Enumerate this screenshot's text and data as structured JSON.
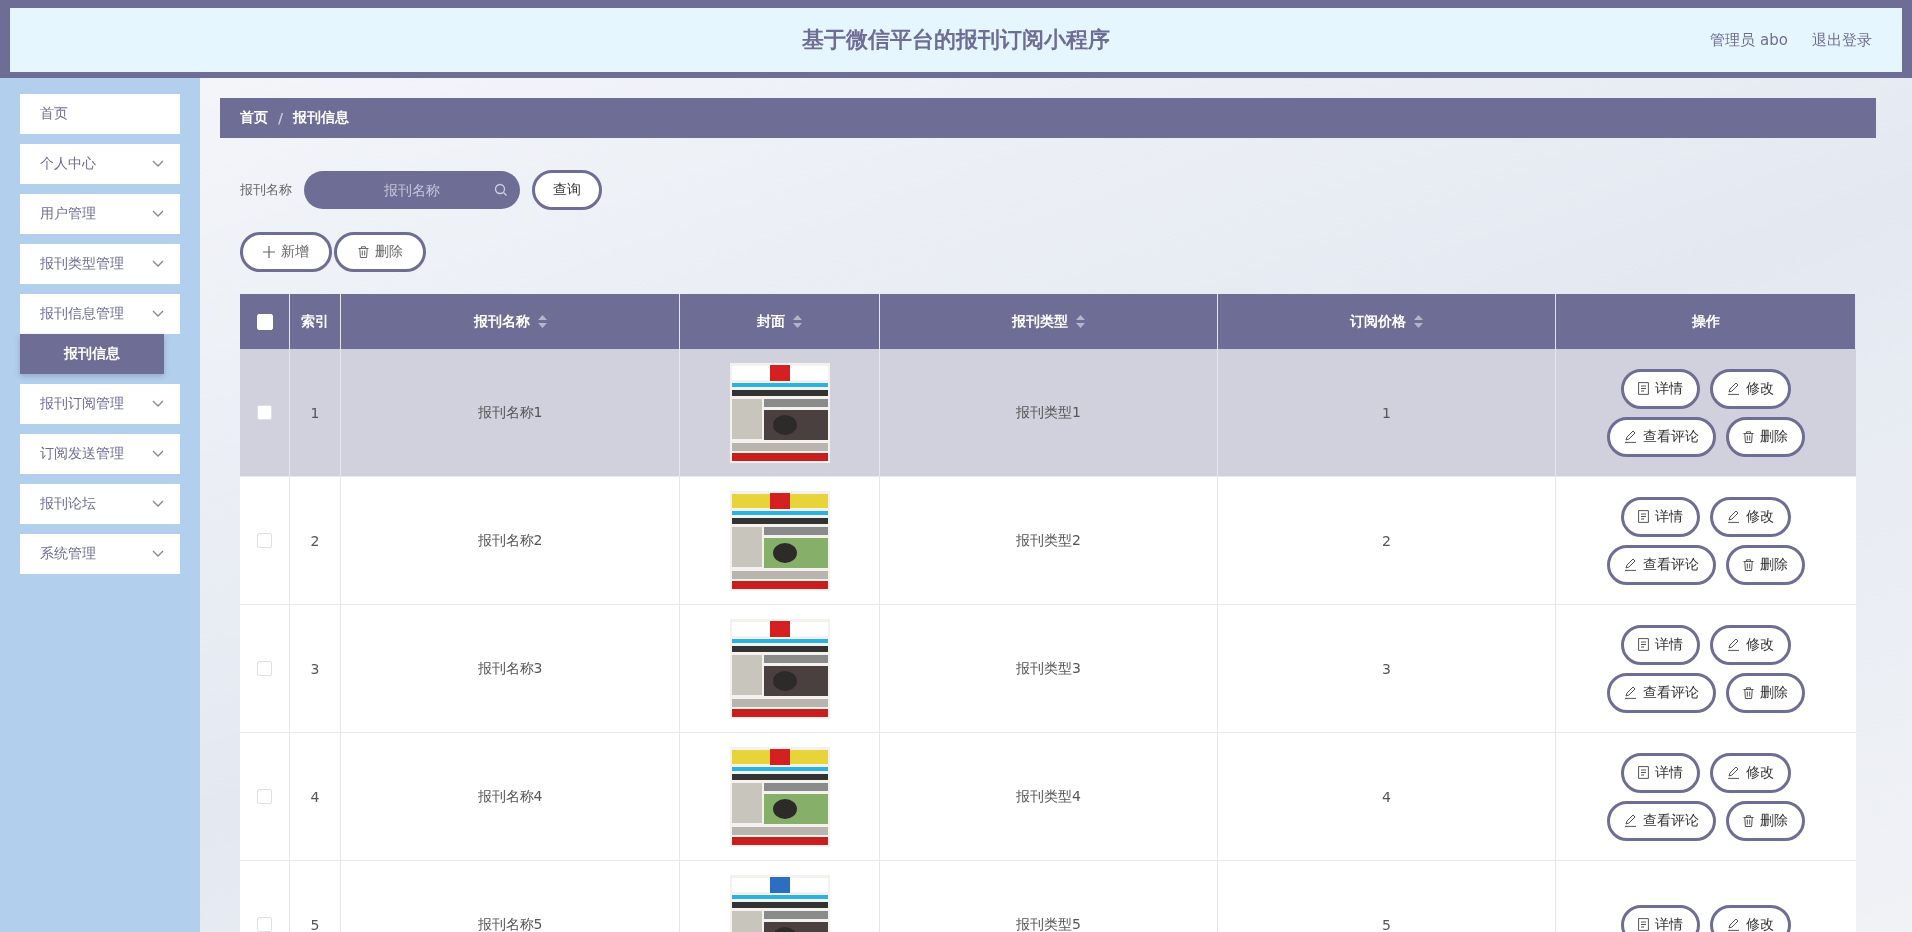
{
  "header": {
    "title": "基于微信平台的报刊订阅小程序",
    "user": "管理员 abo",
    "logout": "退出登录"
  },
  "sidebar": {
    "items": [
      {
        "label": "首页",
        "kind": "link"
      },
      {
        "label": "个人中心",
        "kind": "submenu"
      },
      {
        "label": "用户管理",
        "kind": "submenu"
      },
      {
        "label": "报刊类型管理",
        "kind": "submenu"
      },
      {
        "label": "报刊信息管理",
        "kind": "submenu",
        "children": [
          {
            "label": "报刊信息",
            "selected": true
          }
        ]
      },
      {
        "label": "报刊订阅管理",
        "kind": "submenu"
      },
      {
        "label": "订阅发送管理",
        "kind": "submenu"
      },
      {
        "label": "报刊论坛",
        "kind": "submenu"
      },
      {
        "label": "系统管理",
        "kind": "submenu"
      }
    ]
  },
  "breadcrumb": [
    "首页",
    "报刊信息"
  ],
  "breadcrumb_separator": "/",
  "search": {
    "label": "报刊名称",
    "placeholder": "报刊名称",
    "button": "查询"
  },
  "toolbar": [
    {
      "label": "新增",
      "kind": "add"
    },
    {
      "label": "删除",
      "kind": "delete"
    }
  ],
  "table": {
    "all_checked": false,
    "columns": [
      {
        "label": "索引",
        "sortable": false
      },
      {
        "label": "报刊名称",
        "sortable": true
      },
      {
        "label": "封面",
        "sortable": true
      },
      {
        "label": "报刊类型",
        "sortable": true
      },
      {
        "label": "订阅价格",
        "sortable": true
      },
      {
        "label": "操作",
        "sortable": false
      }
    ],
    "rows": [
      {
        "checked": false,
        "highlighted": true,
        "index": "1",
        "name": "报刊名称1",
        "cover": {
          "kind": "picture"
        },
        "type": "报刊类型1",
        "price": "1",
        "actions": [
          {
            "label": "详情",
            "kind": "detail"
          },
          {
            "label": "修改",
            "kind": "edit"
          },
          {
            "label": "查看评论",
            "kind": "edit"
          },
          {
            "label": "删除",
            "kind": "delete"
          }
        ]
      },
      {
        "checked": false,
        "highlighted": false,
        "index": "2",
        "name": "报刊名称2",
        "cover": {
          "kind": "picture"
        },
        "type": "报刊类型2",
        "price": "2",
        "actions": [
          {
            "label": "详情",
            "kind": "detail"
          },
          {
            "label": "修改",
            "kind": "edit"
          },
          {
            "label": "查看评论",
            "kind": "edit"
          },
          {
            "label": "删除",
            "kind": "delete"
          }
        ]
      },
      {
        "checked": false,
        "highlighted": false,
        "index": "3",
        "name": "报刊名称3",
        "cover": {
          "kind": "picture"
        },
        "type": "报刊类型3",
        "price": "3",
        "actions": [
          {
            "label": "详情",
            "kind": "detail"
          },
          {
            "label": "修改",
            "kind": "edit"
          },
          {
            "label": "查看评论",
            "kind": "edit"
          },
          {
            "label": "删除",
            "kind": "delete"
          }
        ]
      },
      {
        "checked": false,
        "highlighted": false,
        "index": "4",
        "name": "报刊名称4",
        "cover": {
          "kind": "picture"
        },
        "type": "报刊类型4",
        "price": "4",
        "actions": [
          {
            "label": "详情",
            "kind": "detail"
          },
          {
            "label": "修改",
            "kind": "edit"
          },
          {
            "label": "查看评论",
            "kind": "edit"
          },
          {
            "label": "删除",
            "kind": "delete"
          }
        ]
      },
      {
        "checked": false,
        "highlighted": false,
        "index": "5",
        "name": "报刊名称5",
        "cover": {
          "kind": "picture"
        },
        "type": "报刊类型5",
        "price": "5",
        "actions": [
          {
            "label": "详情",
            "kind": "detail"
          },
          {
            "label": "修改",
            "kind": "edit"
          }
        ]
      }
    ]
  }
}
